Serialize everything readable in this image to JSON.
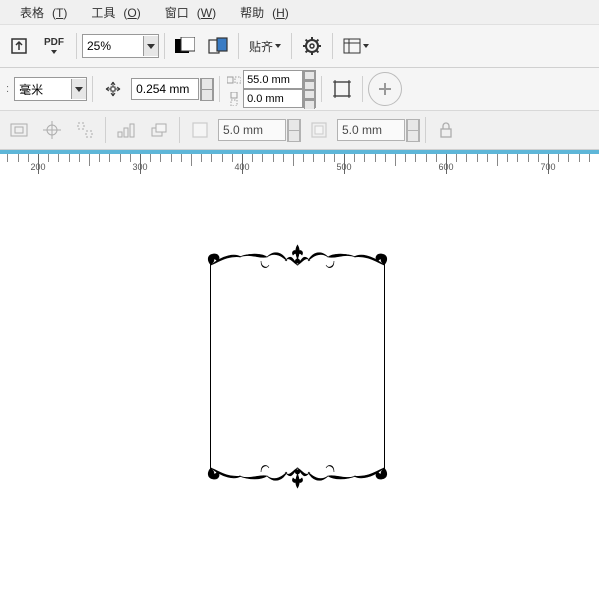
{
  "menu": {
    "table": "表格",
    "table_key": "T",
    "tools": "工具",
    "tools_key": "O",
    "window": "窗口",
    "window_key": "W",
    "help": "帮助",
    "help_key": "H"
  },
  "toolbar": {
    "zoom": "25%",
    "pdf_label": "PDF",
    "snap_label": "贴齐"
  },
  "props": {
    "unit": "毫米",
    "stroke": "0.254 mm",
    "width": "55.0 mm",
    "height": "0.0 mm"
  },
  "props2": {
    "dup_x": "5.0 mm",
    "dup_y": "5.0 mm"
  },
  "ruler": {
    "marks": [
      200,
      300,
      400,
      500,
      600,
      700
    ],
    "start": 175,
    "step": 100
  },
  "chart_data": null
}
